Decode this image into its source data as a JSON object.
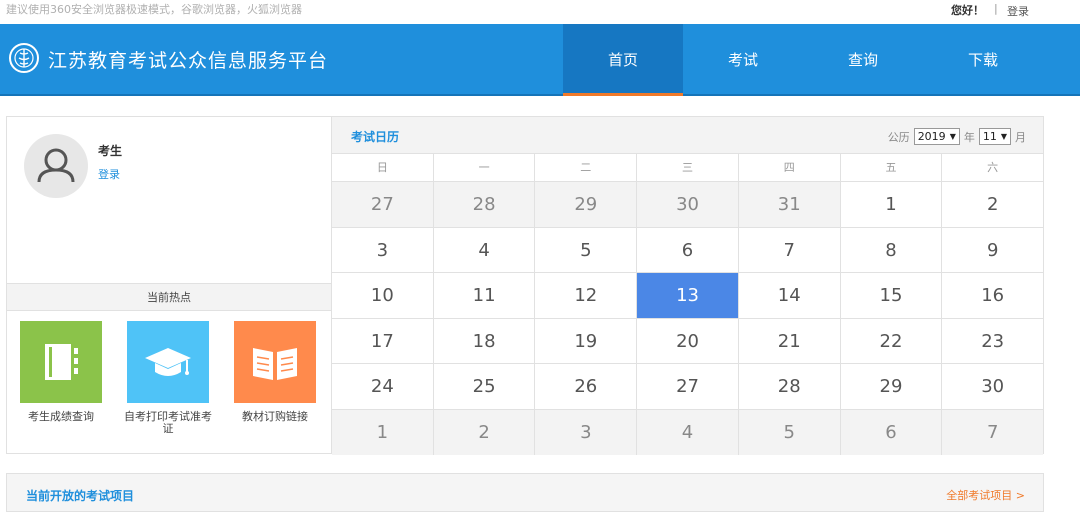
{
  "topbar": {
    "notice": "建议使用360安全浏览器极速模式，谷歌浏览器，火狐浏览器",
    "greeting": "您好！",
    "separator": "|",
    "login": "登录"
  },
  "header": {
    "title": "江苏教育考试公众信息服务平台",
    "nav": [
      "首页",
      "考试",
      "查询",
      "下载"
    ]
  },
  "profile": {
    "name": "考生",
    "login": "登录",
    "hot_title": "当前热点",
    "hot_items": [
      {
        "label": "考生成绩查询",
        "color": "#8bc34a",
        "icon": "notebook-icon"
      },
      {
        "label": "自考打印考试准考证",
        "color": "#4fc3f7",
        "icon": "graduation-cap-icon"
      },
      {
        "label": "教材订购链接",
        "color": "#ff8a4c",
        "icon": "open-book-icon"
      }
    ]
  },
  "calendar": {
    "title": "考试日历",
    "era_label": "公历",
    "year": "2019",
    "year_unit": "年",
    "month": "11",
    "month_unit": "月",
    "weekdays": [
      "日",
      "一",
      "二",
      "三",
      "四",
      "五",
      "六"
    ],
    "weeks": [
      [
        {
          "d": "27",
          "o": true
        },
        {
          "d": "28",
          "o": true
        },
        {
          "d": "29",
          "o": true
        },
        {
          "d": "30",
          "o": true
        },
        {
          "d": "31",
          "o": true
        },
        {
          "d": "1"
        },
        {
          "d": "2"
        }
      ],
      [
        {
          "d": "3"
        },
        {
          "d": "4"
        },
        {
          "d": "5"
        },
        {
          "d": "6"
        },
        {
          "d": "7"
        },
        {
          "d": "8"
        },
        {
          "d": "9"
        }
      ],
      [
        {
          "d": "10"
        },
        {
          "d": "11"
        },
        {
          "d": "12"
        },
        {
          "d": "13",
          "t": true
        },
        {
          "d": "14"
        },
        {
          "d": "15"
        },
        {
          "d": "16"
        }
      ],
      [
        {
          "d": "17"
        },
        {
          "d": "18"
        },
        {
          "d": "19"
        },
        {
          "d": "20"
        },
        {
          "d": "21"
        },
        {
          "d": "22"
        },
        {
          "d": "23"
        }
      ],
      [
        {
          "d": "24"
        },
        {
          "d": "25"
        },
        {
          "d": "26"
        },
        {
          "d": "27"
        },
        {
          "d": "28"
        },
        {
          "d": "29"
        },
        {
          "d": "30"
        }
      ],
      [
        {
          "d": "1",
          "o": true
        },
        {
          "d": "2",
          "o": true
        },
        {
          "d": "3",
          "o": true
        },
        {
          "d": "4",
          "o": true
        },
        {
          "d": "5",
          "o": true
        },
        {
          "d": "6",
          "o": true
        },
        {
          "d": "7",
          "o": true
        }
      ]
    ]
  },
  "open_exams": {
    "title": "当前开放的考试项目",
    "more": "全部考试项目 >"
  },
  "colors": {
    "brand": "#1f8fdc",
    "nav_active": "#1677c2",
    "accent": "#f07a2a",
    "today": "#4b87e6"
  }
}
